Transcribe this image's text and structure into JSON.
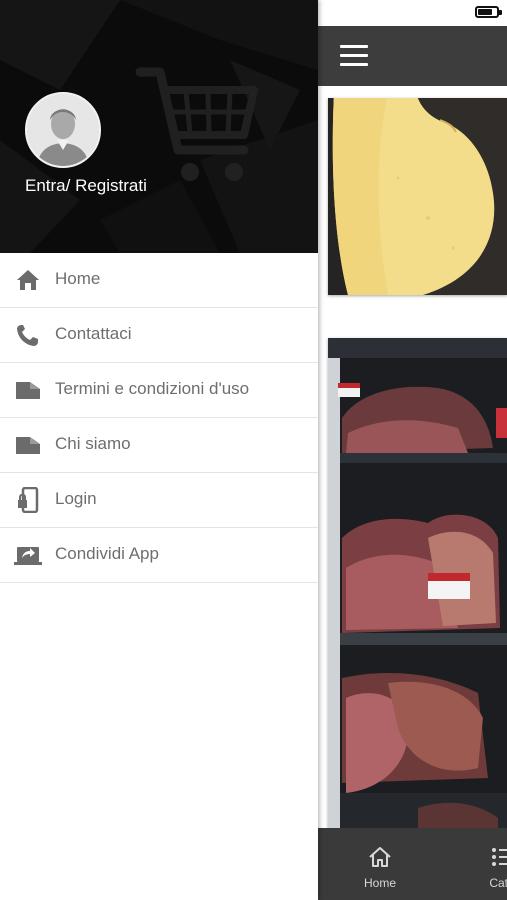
{
  "status_bar": {
    "battery_level": 0.8
  },
  "drawer": {
    "header": {
      "login_label": "Entra/ Registrati",
      "background_icon": "cart-icon"
    },
    "items": [
      {
        "label": "Home",
        "icon": "home-icon"
      },
      {
        "label": "Contattaci",
        "icon": "phone-icon"
      },
      {
        "label": "Termini e condizioni d'uso",
        "icon": "folder-icon"
      },
      {
        "label": "Chi siamo",
        "icon": "folder-icon"
      },
      {
        "label": "Login",
        "icon": "phone-lock-icon"
      },
      {
        "label": "Condividi App",
        "icon": "share-screen-icon"
      }
    ]
  },
  "app": {
    "header": {
      "menu_icon": "hamburger-icon"
    },
    "bottom_nav": {
      "items": [
        {
          "label": "Home",
          "icon": "home-outline-icon"
        },
        {
          "label": "Cate",
          "icon": "categories-icon"
        }
      ]
    }
  },
  "colors": {
    "drawer_header_bg": "#0b0b0b",
    "app_bar_bg": "#3d3d3d",
    "bottom_bar_bg": "#3a3a3a",
    "menu_text": "#6e6e6e",
    "menu_icon": "#6b6b6b"
  }
}
